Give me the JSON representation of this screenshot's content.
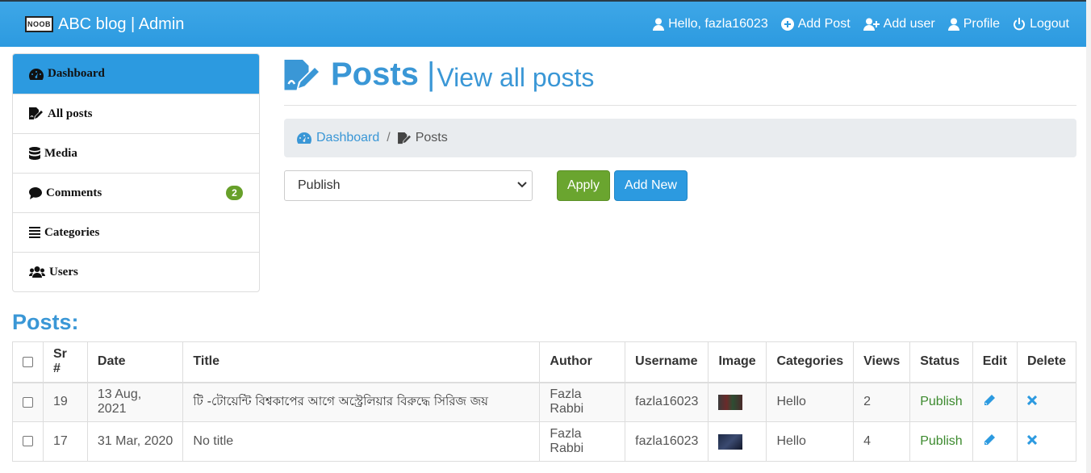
{
  "navbar": {
    "brand_logo_text": "NOOB",
    "brand_title": "ABC blog | Admin",
    "greeting": "Hello, fazla16023",
    "add_post": "Add Post",
    "add_user": "Add user",
    "profile": "Profile",
    "logout": "Logout"
  },
  "sidebar": {
    "items": [
      {
        "label": "Dashboard",
        "icon": "tachometer-icon",
        "active": true
      },
      {
        "label": "All posts",
        "icon": "file-signature-icon"
      },
      {
        "label": "Media",
        "icon": "database-icon"
      },
      {
        "label": "Comments",
        "icon": "comment-icon",
        "badge": "2"
      },
      {
        "label": "Categories",
        "icon": "list-icon"
      },
      {
        "label": "Users",
        "icon": "users-icon"
      }
    ]
  },
  "page_header": {
    "title": "Posts",
    "separator": "|",
    "subtitle": "View all posts"
  },
  "breadcrumb": {
    "home": "Dashboard",
    "separator": "/",
    "current": "Posts"
  },
  "bulk_actions": {
    "selected": "Publish",
    "apply_label": "Apply",
    "add_new_label": "Add New"
  },
  "posts_table": {
    "heading": "Posts:",
    "columns": [
      "Sr #",
      "Date",
      "Title",
      "Author",
      "Username",
      "Image",
      "Categories",
      "Views",
      "Status",
      "Edit",
      "Delete"
    ],
    "rows": [
      {
        "sr": "19",
        "date": "13 Aug, 2021",
        "title": "টি -টোয়েন্টি বিশ্বকাপের আগে অস্ট্রেলিয়ার বিরুদ্ধে সিরিজ জয়",
        "author": "Fazla Rabbi",
        "username": "fazla16023",
        "categories": "Hello",
        "views": "2",
        "status": "Publish"
      },
      {
        "sr": "17",
        "date": "31 Mar, 2020",
        "title": "No title",
        "author": "Fazla Rabbi",
        "username": "fazla16023",
        "categories": "Hello",
        "views": "4",
        "status": "Publish"
      }
    ]
  },
  "colors": {
    "primary": "#2c9ae0",
    "heading_blue": "#3a97d6",
    "success": "#6aa52f",
    "status_green": "#3c8a2e"
  }
}
